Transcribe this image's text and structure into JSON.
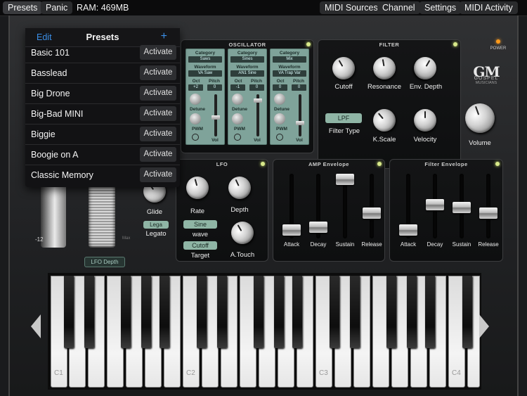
{
  "topbar": {
    "presets": "Presets",
    "panic": "Panic",
    "ram": "RAM: 469MB",
    "midi_sources": "MIDI Sources",
    "channel": "Channel",
    "settings": "Settings",
    "midi_activity": "MIDI Activity"
  },
  "presets_popover": {
    "edit": "Edit",
    "title": "Presets",
    "add": "+",
    "items": [
      {
        "name": "Basic 101",
        "action": "Activate"
      },
      {
        "name": "Basslead",
        "action": "Activate"
      },
      {
        "name": "Big Drone",
        "action": "Activate"
      },
      {
        "name": "Big-Bad MINI",
        "action": "Activate"
      },
      {
        "name": "Biggie",
        "action": "Activate"
      },
      {
        "name": "Boogie on A",
        "action": "Activate"
      },
      {
        "name": "Classic Memory",
        "action": "Activate"
      }
    ]
  },
  "oscillator": {
    "title": "OSCILLATOR",
    "columns": [
      {
        "category_label": "Category",
        "category": "Saws",
        "waveform_label": "Waveform",
        "waveform": "VA Saw",
        "oct_label": "Oct",
        "oct": "+2",
        "pitch_label": "Pitch",
        "pitch": "0",
        "detune": "Detune",
        "pwm": "PWM",
        "vol": "Vol"
      },
      {
        "category_label": "Category",
        "category": "Sines",
        "waveform_label": "Waveform",
        "waveform": "AN1 Sine",
        "oct_label": "Oct",
        "oct": "-1",
        "pitch_label": "Pitch",
        "pitch": "0",
        "detune": "Detune",
        "pwm": "PWM",
        "vol": "Vol"
      },
      {
        "category_label": "Category",
        "category": "Mix",
        "waveform_label": "Waveform",
        "waveform": "VA Trap Var",
        "oct_label": "Oct",
        "oct": "0",
        "pitch_label": "Pitch",
        "pitch": "0",
        "detune": "Detune",
        "pwm": "PWM",
        "vol": "Vol"
      }
    ]
  },
  "filter": {
    "title": "FILTER",
    "cutoff": "Cutoff",
    "resonance": "Resonance",
    "env_depth": "Env. Depth",
    "type_value": "LPF",
    "type_label": "Filter Type",
    "kscale": "K.Scale",
    "velocity": "Velocity"
  },
  "power_label": "POWER",
  "logo": {
    "mark": "GM",
    "line1": "GOSPEL",
    "line2": "MUSICIANS"
  },
  "volume_label": "Volume",
  "glide": {
    "label": "Glide",
    "legato_value": "Lega",
    "legato_label": "Legato"
  },
  "wheels": {
    "min_label": "-12",
    "max_label": "Max",
    "lfo_depth": "LFO Depth"
  },
  "lfo": {
    "title": "LFO",
    "rate": "Rate",
    "depth": "Depth",
    "wave_value": "Sine",
    "wave_label": "wave",
    "target_value": "Cutoff",
    "target_label": "Target",
    "atouch": "A.Touch"
  },
  "amp_env": {
    "title": "AMP Envelope",
    "labels": [
      "Attack",
      "Decay",
      "Sustain",
      "Release"
    ]
  },
  "filter_env": {
    "title": "Filter Envelope",
    "labels": [
      "Attack",
      "Decay",
      "Sustain",
      "Release"
    ]
  },
  "keyboard": {
    "notes": [
      "C1",
      "C2",
      "C3",
      "C4"
    ]
  },
  "colors": {
    "accent": "#3b8fe8",
    "lcd": "#7fa39a",
    "led": "#d8e98a"
  }
}
